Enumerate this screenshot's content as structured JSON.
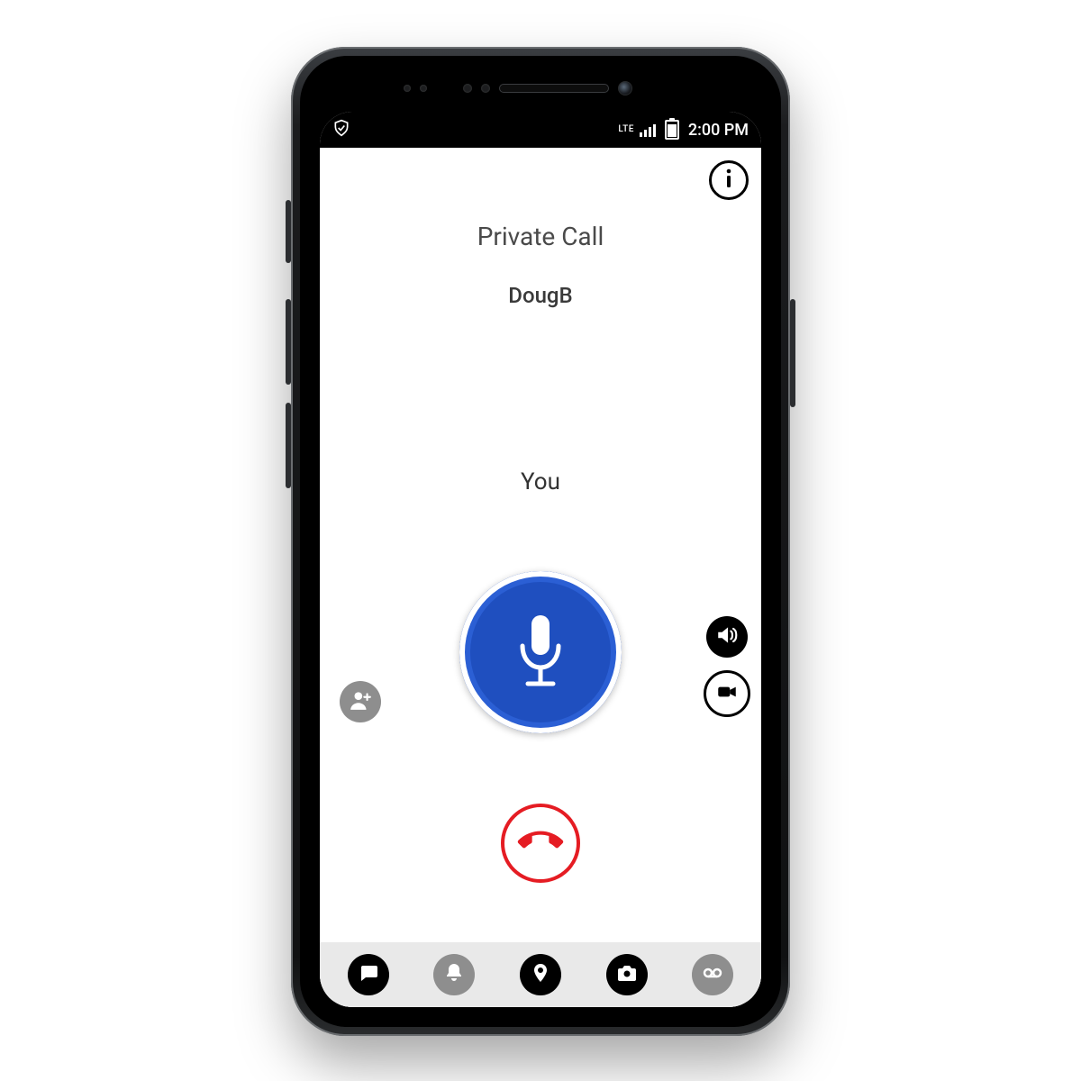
{
  "statusbar": {
    "network_label": "LTE",
    "time": "2:00 PM",
    "icons": {
      "left_app": "shield-check-icon",
      "signal": "cellular-signal-icon",
      "battery": "battery-icon"
    }
  },
  "header": {
    "info_icon": "info-icon"
  },
  "call": {
    "type_label": "Private Call",
    "contact_name": "DougB",
    "speaking_label": "You"
  },
  "controls": {
    "ptt_icon": "microphone-icon",
    "hangup_icon": "phone-hangup-icon",
    "add_participant_icon": "add-person-icon",
    "speaker_icon": "speaker-icon",
    "video_icon": "video-camera-icon"
  },
  "bottomnav": {
    "items": [
      {
        "name": "nav-messages",
        "icon": "chat-bubble-icon",
        "active": true
      },
      {
        "name": "nav-alerts",
        "icon": "bell-icon",
        "active": false
      },
      {
        "name": "nav-location",
        "icon": "map-pin-icon",
        "active": true
      },
      {
        "name": "nav-camera",
        "icon": "camera-icon",
        "active": true
      },
      {
        "name": "nav-voicemail",
        "icon": "voicemail-icon",
        "active": false
      }
    ]
  },
  "colors": {
    "ptt_blue": "#1f4fbf",
    "hangup_red": "#e51c23",
    "inactive_gray": "#8e8e8e",
    "nav_bg": "#e9e9e9"
  }
}
